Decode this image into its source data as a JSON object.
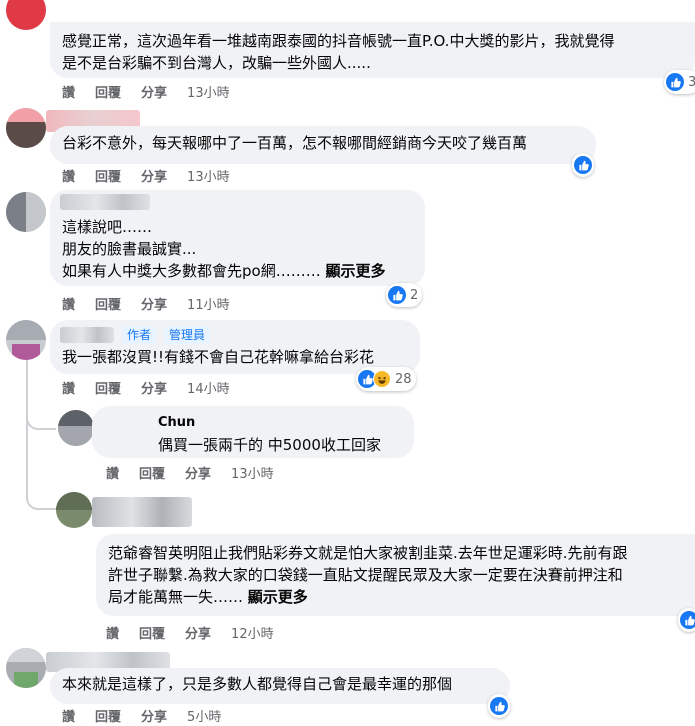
{
  "actions": {
    "like": "讚",
    "reply": "回覆",
    "share": "分享"
  },
  "comments": [
    {
      "text": "感覺正常，這次過年看一堆越南跟泰國的抖音帳號一直P.O.中大獎的影片，我就覺得\n是不是台彩騙不到台灣人，改騙一些外國人.....",
      "time": "13小時",
      "reaction_count": "3"
    },
    {
      "text": "台彩不意外，每天報哪中了一百萬，怎不報哪間經銷商今天咬了幾百萬",
      "time": "13小時"
    },
    {
      "text": "這樣說吧……\n朋友的臉書最誠實...\n如果有人中獎大多數都會先po網……… ",
      "more": "顯示更多",
      "time": "11小時",
      "reaction_count": "2"
    },
    {
      "tags": [
        "作者",
        "管理員"
      ],
      "text": "我一張都沒買!!有錢不會自己花幹嘛拿給台彩花",
      "time": "14小時",
      "reaction_count": "28"
    },
    {
      "name": "Chun",
      "text": "偶買一張兩千的 中5000收工回家",
      "time": "13小時"
    },
    {
      "text": "范爺睿智英明阻止我們貼彩券文就是怕大家被割韭菜.去年世足運彩時.先前有跟\n許世子聯繫.為救大家的口袋錢一直貼文提醒民眾及大家一定要在決賽前押注和\n局才能萬無一失…… ",
      "more": "顯示更多",
      "time": "12小時"
    },
    {
      "text": "本來就是這樣了，只是多數人都覺得自己會是最幸運的那個",
      "time": "5小時"
    }
  ],
  "colors": {
    "bubble": "#f0f2f5",
    "meta": "#65676b",
    "like": "#1877f2",
    "haha": "#f7b928",
    "tag": "#1877f2"
  }
}
